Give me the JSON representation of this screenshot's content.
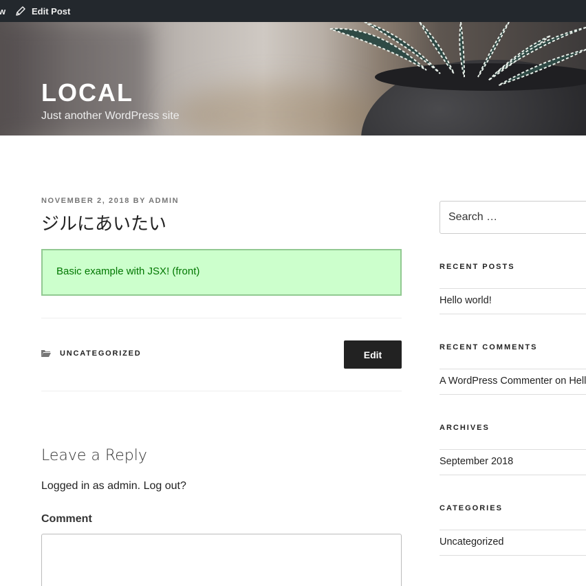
{
  "adminbar": {
    "partial_left": "w",
    "edit_post": "Edit Post"
  },
  "site": {
    "title": "LOCAL",
    "description": "Just another WordPress site"
  },
  "post": {
    "meta_date": "NOVEMBER 2, 2018",
    "meta_by": "BY",
    "meta_author": "ADMIN",
    "title": "ジルにあいたい",
    "notice": "Basic example with JSX! (front)",
    "category": "UNCATEGORIZED",
    "edit_label": "Edit"
  },
  "comments": {
    "title": "Leave a Reply",
    "logged_in_prefix": "Logged in as admin.",
    "logout": "Log out?",
    "comment_label": "Comment"
  },
  "sidebar": {
    "search_placeholder": "Search …",
    "recent_posts_title": "RECENT POSTS",
    "recent_posts": [
      "Hello world!"
    ],
    "recent_comments_title": "RECENT COMMENTS",
    "recent_comments_author": "A WordPress Commenter",
    "recent_comments_on": "on",
    "recent_comments_post": "Hell",
    "archives_title": "ARCHIVES",
    "archives": [
      "September 2018"
    ],
    "categories_title": "CATEGORIES",
    "categories": [
      "Uncategorized"
    ]
  },
  "icons": {
    "edit_post": "pencil-icon",
    "category": "folder-icon"
  }
}
